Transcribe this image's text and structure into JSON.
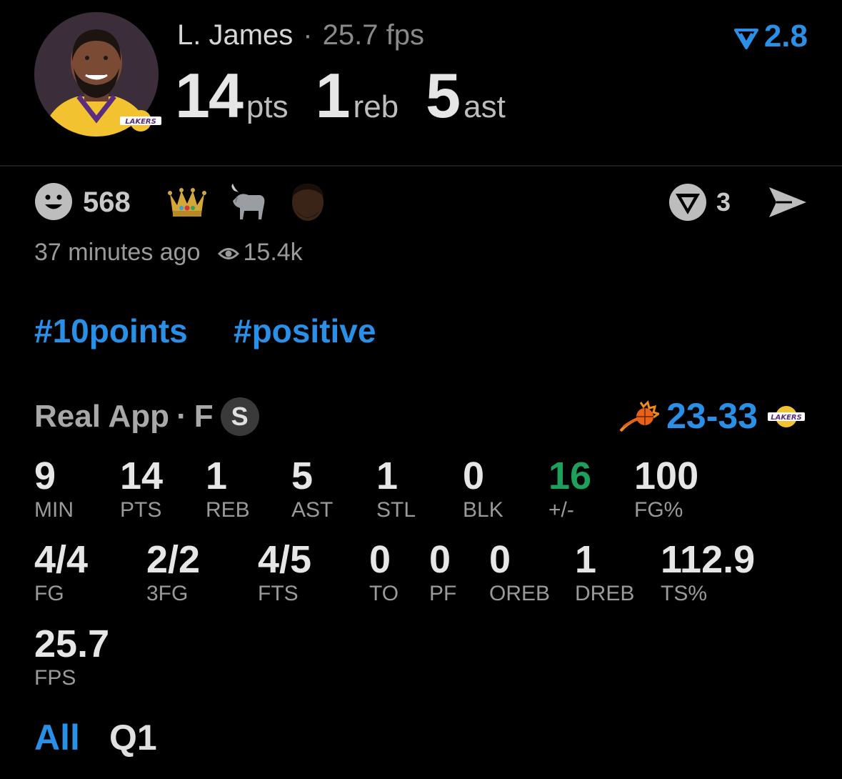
{
  "player": {
    "name": "L. James",
    "fps_label": "25.7 fps",
    "pts": "14",
    "pts_unit": "pts",
    "reb": "1",
    "reb_unit": "reb",
    "ast": "5",
    "ast_unit": "ast",
    "team_logo_text": "LAKERS"
  },
  "rating": {
    "value": "2.8",
    "color": "#2a8fe6"
  },
  "reactions": {
    "count": "568",
    "emoji_names": [
      "smiley-icon",
      "crown-icon",
      "goat-icon",
      "player-face-icon"
    ],
    "comments": "3"
  },
  "meta": {
    "time": "37 minutes ago",
    "views": "15.4k"
  },
  "tags": [
    "#10points",
    "#positive"
  ],
  "source": {
    "app": "Real App",
    "separator": "·",
    "status": "F",
    "badge": "S"
  },
  "game_score": {
    "away": "23",
    "dash": "-",
    "home": "33",
    "home_logo_text": "LAKERS"
  },
  "stats_row1": [
    {
      "value": "9",
      "label": "MIN"
    },
    {
      "value": "14",
      "label": "PTS"
    },
    {
      "value": "1",
      "label": "REB"
    },
    {
      "value": "5",
      "label": "AST"
    },
    {
      "value": "1",
      "label": "STL"
    },
    {
      "value": "0",
      "label": "BLK"
    },
    {
      "value": "16",
      "label": "+/-"
    },
    {
      "value": "100",
      "label": "FG%"
    }
  ],
  "stats_row2": [
    {
      "value": "4/4",
      "label": "FG"
    },
    {
      "value": "2/2",
      "label": "3FG"
    },
    {
      "value": "4/5",
      "label": "FTS"
    },
    {
      "value": "0",
      "label": "TO"
    },
    {
      "value": "0",
      "label": "PF"
    },
    {
      "value": "0",
      "label": "OREB"
    },
    {
      "value": "1",
      "label": "DREB"
    },
    {
      "value": "112.9",
      "label": "TS%"
    }
  ],
  "stats_row3": [
    {
      "value": "25.7",
      "label": "FPS"
    }
  ],
  "periods": [
    "All",
    "Q1"
  ],
  "colors": {
    "accent": "#2a8fe6",
    "positive": "#1ea05c",
    "background": "#000000"
  }
}
